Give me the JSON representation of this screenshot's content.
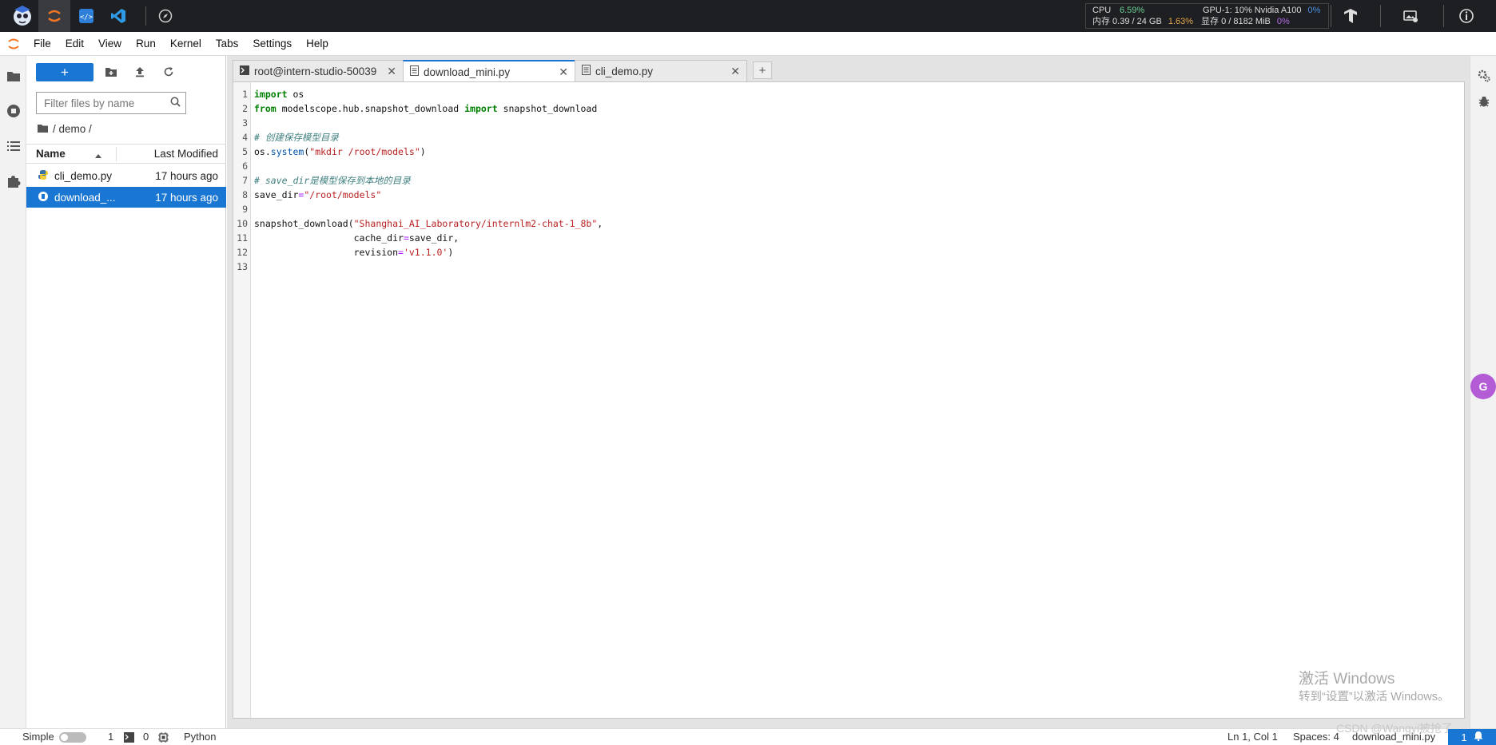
{
  "topbar": {
    "stats": {
      "cpu_label": "CPU",
      "cpu_value": "6.59%",
      "gpu_label": "GPU-1: 10% Nvidia A100",
      "gpu_value": "0%",
      "mem_label": "内存 0.39 / 24 GB",
      "mem_value": "1.63%",
      "vram_label": "显存 0 / 8182 MiB",
      "vram_value": "0%"
    }
  },
  "menubar": {
    "items": [
      "File",
      "Edit",
      "View",
      "Run",
      "Kernel",
      "Tabs",
      "Settings",
      "Help"
    ]
  },
  "filebrowser": {
    "new_label": "+",
    "filter_placeholder": "Filter files by name",
    "breadcrumb": "/ demo /",
    "col_name": "Name",
    "col_modified": "Last Modified",
    "files": [
      {
        "name": "cli_demo.py",
        "modified": "17 hours ago",
        "selected": false
      },
      {
        "name": "download_...",
        "modified": "17 hours ago",
        "selected": true
      }
    ]
  },
  "tabs": [
    {
      "label": "root@intern-studio-50039",
      "active": false
    },
    {
      "label": "download_mini.py",
      "active": true
    },
    {
      "label": "cli_demo.py",
      "active": false
    }
  ],
  "add_tab_label": "+",
  "editor": {
    "line_numbers": [
      "1",
      "2",
      "3",
      "4",
      "5",
      "6",
      "7",
      "8",
      "9",
      "10",
      "11",
      "12",
      "13"
    ],
    "code": {
      "l1_kw": "import",
      "l1_rest": " os",
      "l2_kw1": "from",
      "l2_mid": " modelscope.hub.snapshot_download ",
      "l2_kw2": "import",
      "l2_rest": " snapshot_download",
      "l4": "# 创建保存模型目录",
      "l5_a": "os.",
      "l5_fn": "system",
      "l5_b": "(",
      "l5_str": "\"mkdir /root/models\"",
      "l5_c": ")",
      "l7": "# save_dir是模型保存到本地的目录",
      "l8_a": "save_dir",
      "l8_op": "=",
      "l8_str": "\"/root/models\"",
      "l10_a": "snapshot_download(",
      "l10_str": "\"Shanghai_AI_Laboratory/internlm2-chat-1_8b\"",
      "l10_b": ",",
      "l11_a": "                  cache_dir",
      "l11_op": "=",
      "l11_b": "save_dir,",
      "l12_a": "                  revision",
      "l12_op": "=",
      "l12_str": "'v1.1.0'",
      "l12_b": ")"
    }
  },
  "statusbar": {
    "mode_label": "Simple",
    "terminals": "1",
    "kernels": "0",
    "language": "Python",
    "position": "Ln 1, Col 1",
    "spaces": "Spaces: 4",
    "filename": "download_mini.py",
    "right_badge": "1"
  },
  "watermark": {
    "line1": "激活 Windows",
    "line2": "转到“设置”以激活 Windows。",
    "csdn": "CSDN @Wangyi被抢了"
  },
  "translate_label": "G"
}
